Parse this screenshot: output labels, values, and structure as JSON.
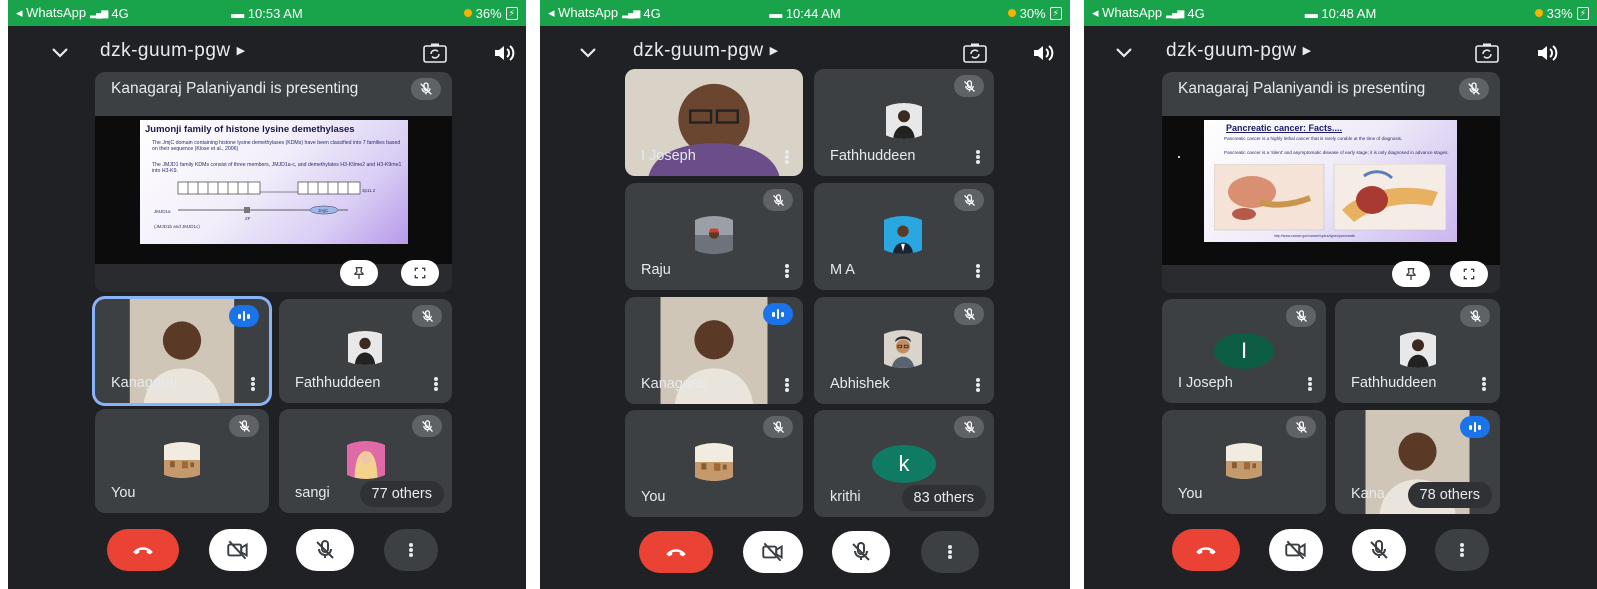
{
  "screens": [
    {
      "status": {
        "app": "◂ WhatsApp",
        "network": "4G",
        "time": "10:53 AM",
        "battery": "36%"
      },
      "meeting_code": "dzk-guum-pgw",
      "presenter_label": "Kanagaraj Palaniyandi is presenting",
      "slide": {
        "title": "Jumonji family of histone lysine demethylases",
        "bullet1": "The JmjC domain containing histone lysine demethylases (KDMs) have been classified into 7 families based on their sequence (Klose et al., 2006)",
        "bullet2": "The JMJD1 family KDMs consist of three members, JMJD1a-c, and demethylates H3-K9me2 and H3-K9me1 into H3-K9.",
        "label_gene": "JMJD1a",
        "label_zf": "ZF",
        "label_jmjc": "JmjC",
        "label_loc": "3p11.2",
        "label_members": "(JMJD1b and JMJD1c)"
      },
      "participants": [
        {
          "name": "Kanagaraj",
          "state": "speaking"
        },
        {
          "name": "Fathhuddeen",
          "state": "muted"
        },
        {
          "name": "You",
          "state": "muted"
        },
        {
          "name": "sangi",
          "state": "muted"
        }
      ],
      "others_count": "77 others"
    },
    {
      "status": {
        "app": "◂ WhatsApp",
        "network": "4G",
        "time": "10:44 AM",
        "battery": "30%"
      },
      "meeting_code": "dzk-guum-pgw",
      "participants": [
        {
          "name": "I Joseph",
          "state": "video"
        },
        {
          "name": "Fathhuddeen",
          "state": "muted"
        },
        {
          "name": "Raju",
          "state": "muted"
        },
        {
          "name": "M A",
          "state": "muted"
        },
        {
          "name": "Kanagaraj",
          "state": "speaking"
        },
        {
          "name": "Abhishek",
          "state": "muted"
        },
        {
          "name": "You",
          "state": "muted"
        },
        {
          "name": "krithi",
          "state": "muted",
          "initial": "k"
        }
      ],
      "others_count": "83 others"
    },
    {
      "status": {
        "app": "◂ WhatsApp",
        "network": "4G",
        "time": "10:48 AM",
        "battery": "33%"
      },
      "meeting_code": "dzk-guum-pgw",
      "presenter_label": "Kanagaraj Palaniyandi is presenting",
      "slide": {
        "title": "Pancreatic cancer: Facts....",
        "bullet1": "Pancreatic cancer is a highly lethal cancer that is rarely curable at the time of diagnosis.",
        "bullet2": "Pancreatic cancer is a 'silent' and asymptomatic disease of early stage; it is only diagnosed in advance stages.",
        "source": "http://www.cancer.gov/cancertopics/types/pancreatic"
      },
      "participants": [
        {
          "name": "I Joseph",
          "state": "muted",
          "initial": "I"
        },
        {
          "name": "Fathhuddeen",
          "state": "muted"
        },
        {
          "name": "You",
          "state": "muted"
        },
        {
          "name": "Kana",
          "state": "speaking"
        }
      ],
      "others_count": "78 others"
    }
  ],
  "colors": {
    "status_bar": "#19a34a",
    "background": "#202124",
    "tile": "#3c4043",
    "end_call": "#ea4335",
    "speaking": "#1a73e8",
    "active_border": "#8ab4f8",
    "initial_k": "#0f7b63",
    "initial_i": "#0d5c44"
  },
  "icons": [
    "chevron-down-icon",
    "caret-right-icon",
    "camera-switch-icon",
    "speaker-icon",
    "mic-off-icon",
    "pin-icon",
    "fullscreen-icon",
    "more-vert-icon",
    "end-call-icon",
    "video-off-icon"
  ]
}
